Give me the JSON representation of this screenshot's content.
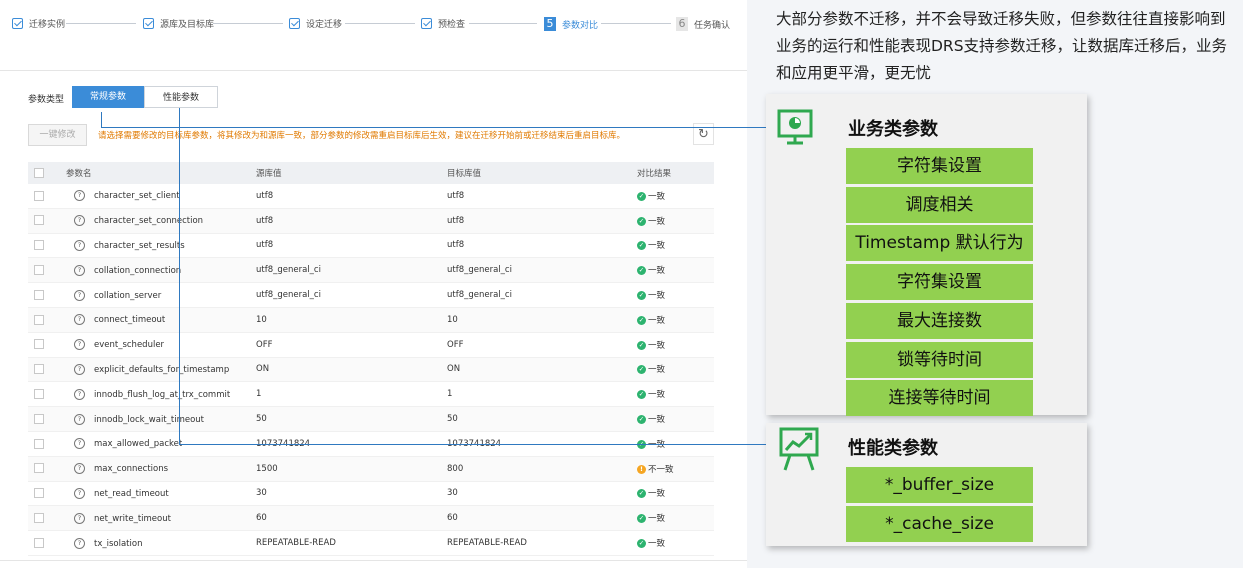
{
  "wizard_steps": [
    {
      "label": "迁移实例",
      "status": "done"
    },
    {
      "label": "源库及目标库",
      "status": "done"
    },
    {
      "label": "设定迁移",
      "status": "done"
    },
    {
      "label": "预检查",
      "status": "done"
    },
    {
      "label": "参数对比",
      "status": "current",
      "number": "5"
    },
    {
      "label": "任务确认",
      "status": "todo",
      "number": "6"
    }
  ],
  "filter": {
    "label": "参数类型",
    "tabs": [
      "常规参数",
      "性能参数"
    ],
    "selected": "常规参数"
  },
  "toolbar": {
    "modify_button": "一键修改",
    "tip": "请选择需要修改的目标库参数，将其修改为和源库一致，部分参数的修改需重启目标库后生效，建议在迁移开始前或迁移结束后重启目标库。"
  },
  "table": {
    "columns": [
      "参数名",
      "源库值",
      "目标库值",
      "对比结果"
    ],
    "rows": [
      {
        "name": "character_set_client",
        "source": "utf8",
        "target": "utf8",
        "result": "一致",
        "status": "ok"
      },
      {
        "name": "character_set_connection",
        "source": "utf8",
        "target": "utf8",
        "result": "一致",
        "status": "ok"
      },
      {
        "name": "character_set_results",
        "source": "utf8",
        "target": "utf8",
        "result": "一致",
        "status": "ok"
      },
      {
        "name": "collation_connection",
        "source": "utf8_general_ci",
        "target": "utf8_general_ci",
        "result": "一致",
        "status": "ok"
      },
      {
        "name": "collation_server",
        "source": "utf8_general_ci",
        "target": "utf8_general_ci",
        "result": "一致",
        "status": "ok"
      },
      {
        "name": "connect_timeout",
        "source": "10",
        "target": "10",
        "result": "一致",
        "status": "ok"
      },
      {
        "name": "event_scheduler",
        "source": "OFF",
        "target": "OFF",
        "result": "一致",
        "status": "ok"
      },
      {
        "name": "explicit_defaults_for_timestamp",
        "source": "ON",
        "target": "ON",
        "result": "一致",
        "status": "ok"
      },
      {
        "name": "innodb_flush_log_at_trx_commit",
        "source": "1",
        "target": "1",
        "result": "一致",
        "status": "ok"
      },
      {
        "name": "innodb_lock_wait_timeout",
        "source": "50",
        "target": "50",
        "result": "一致",
        "status": "ok"
      },
      {
        "name": "max_allowed_packet",
        "source": "1073741824",
        "target": "1073741824",
        "result": "一致",
        "status": "ok"
      },
      {
        "name": "max_connections",
        "source": "1500",
        "target": "800",
        "result": "不一致",
        "status": "warn"
      },
      {
        "name": "net_read_timeout",
        "source": "30",
        "target": "30",
        "result": "一致",
        "status": "ok"
      },
      {
        "name": "net_write_timeout",
        "source": "60",
        "target": "60",
        "result": "一致",
        "status": "ok"
      },
      {
        "name": "tx_isolation",
        "source": "REPEATABLE-READ",
        "target": "REPEATABLE-READ",
        "result": "一致",
        "status": "ok"
      }
    ]
  },
  "callout": {
    "description": "大部分参数不迁移，并不会导致迁移失败，但参数往往直接影响到业务的运行和性能表现DRS支持参数迁移，让数据库迁移后，业务和应用更平滑，更无忧",
    "business": {
      "title": "业务类参数",
      "icon": "presentation-chart-icon",
      "items": [
        "字符集设置",
        "调度相关",
        "Timestamp 默认行为",
        "字符集设置",
        "最大连接数",
        "锁等待时间",
        "连接等待时间"
      ]
    },
    "performance": {
      "title": "性能类参数",
      "icon": "trend-board-icon",
      "items": [
        "*_buffer_size",
        "*_cache_size"
      ]
    }
  },
  "colors": {
    "primary_blue": "#3b8cd8",
    "ok_green": "#2db36f",
    "warn_orange": "#f5a623",
    "tip_orange": "#e07a00",
    "tag_green": "#92d050",
    "icon_green": "#2fa84f",
    "connector_blue": "#2f79c0"
  }
}
